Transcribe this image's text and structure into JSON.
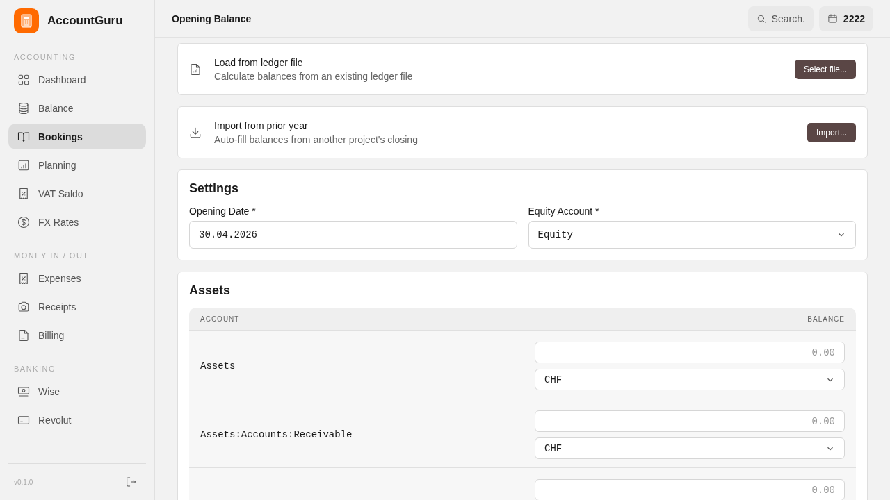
{
  "app": {
    "name": "AccountGuru"
  },
  "sidebar": {
    "sections": [
      {
        "heading": "ACCOUNTING",
        "items": [
          {
            "label": "Dashboard",
            "selected": false
          },
          {
            "label": "Balance",
            "selected": false
          },
          {
            "label": "Bookings",
            "selected": true
          },
          {
            "label": "Planning",
            "selected": false
          },
          {
            "label": "VAT Saldo",
            "selected": false
          },
          {
            "label": "FX Rates",
            "selected": false
          }
        ]
      },
      {
        "heading": "MONEY IN / OUT",
        "items": [
          {
            "label": "Expenses",
            "selected": false
          },
          {
            "label": "Receipts",
            "selected": false
          },
          {
            "label": "Billing",
            "selected": false
          }
        ]
      },
      {
        "heading": "BANKING",
        "items": [
          {
            "label": "Wise",
            "selected": false
          },
          {
            "label": "Revolut",
            "selected": false
          }
        ]
      }
    ],
    "version": "v0.1.0"
  },
  "header": {
    "title": "Opening Balance",
    "search": {
      "placeholder": "Search."
    },
    "year": "2222"
  },
  "actions": [
    {
      "title": "Load from ledger file",
      "description": "Calculate balances from an existing ledger file",
      "button": "Select file..."
    },
    {
      "title": "Import from prior year",
      "description": "Auto-fill balances from another project's closing",
      "button": "Import..."
    }
  ],
  "settings": {
    "title": "Settings",
    "opening_date": {
      "label": "Opening Date *",
      "value": "30.04.2026"
    },
    "equity_account": {
      "label": "Equity Account *",
      "value": "Equity"
    }
  },
  "assets": {
    "title": "Assets",
    "columns": [
      "ACCOUNT",
      "BALANCE"
    ],
    "rows": [
      {
        "account": "Assets",
        "balance_placeholder": "0.00",
        "currency": "CHF"
      },
      {
        "account": "Assets:Accounts:Receivable",
        "balance_placeholder": "0.00",
        "currency": "CHF"
      },
      {
        "balance_placeholder": "0.00"
      }
    ]
  }
}
